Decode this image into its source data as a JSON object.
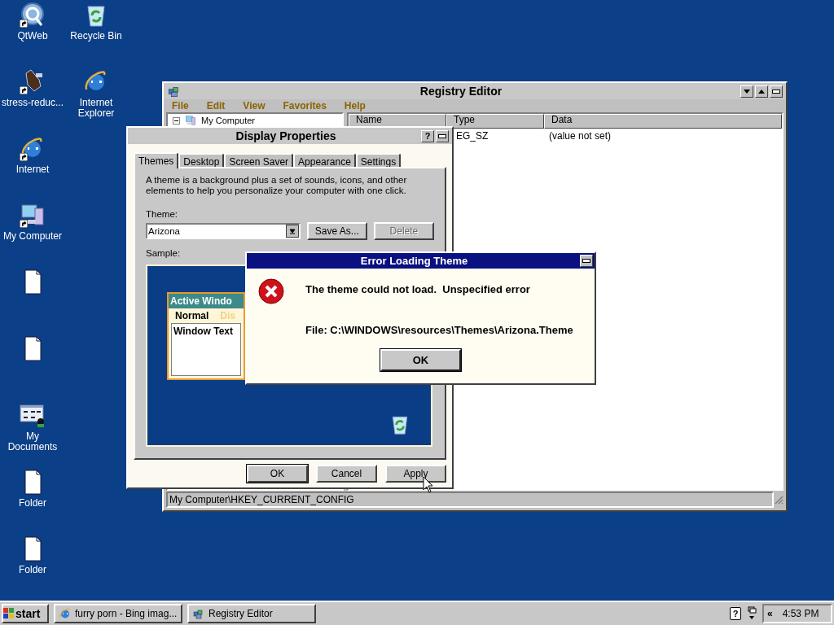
{
  "desktop_columns": [
    [
      {
        "label": "QtWeb",
        "kind": "qt",
        "shortcut": true
      },
      {
        "label": "stress-reduc...",
        "kind": "tool",
        "shortcut": true
      },
      {
        "label": "Internet",
        "kind": "ie",
        "shortcut": true
      },
      {
        "label": "My Computer",
        "kind": "computer",
        "shortcut": true
      },
      {
        "kind": "file",
        "shortcut": false
      },
      {
        "kind": "file",
        "shortcut": false
      },
      {
        "label": "My Documents",
        "kind": "documents",
        "shortcut": false
      },
      {
        "label": "Folder",
        "kind": "file",
        "shortcut": false
      },
      {
        "label": "Folder",
        "kind": "file",
        "shortcut": false
      }
    ],
    [
      {
        "label": "Recycle Bin",
        "kind": "recycle",
        "shortcut": false
      },
      {
        "label": "Internet Explorer",
        "kind": "ie",
        "shortcut": false
      }
    ]
  ],
  "registry_editor": {
    "title": "Registry Editor",
    "menu": [
      "File",
      "Edit",
      "View",
      "Favorites",
      "Help"
    ],
    "tree": {
      "label": "My Computer",
      "expanded": true
    },
    "columns": [
      "Name",
      "Type",
      "Data"
    ],
    "rows": [
      {
        "type": "EG_SZ",
        "data": "(value not set)"
      }
    ],
    "status_bar": "My Computer\\HKEY_CURRENT_CONFIG"
  },
  "display_properties": {
    "title": "Display Properties",
    "help": "?",
    "tabs": [
      {
        "label": "Themes",
        "selected": true
      },
      {
        "label": "Desktop",
        "selected": false
      },
      {
        "label": "Screen Saver",
        "selected": false
      },
      {
        "label": "Appearance",
        "selected": false
      },
      {
        "label": "Settings",
        "selected": false
      }
    ],
    "description": "A theme is a background plus a set of sounds, icons, and other elements to help you personalize your computer with one click.",
    "theme_label": "Theme:",
    "theme_value": "Arizona",
    "theme_buttons": [
      {
        "label": "Save As...",
        "disabled": false
      },
      {
        "label": "Delete",
        "disabled": true
      }
    ],
    "sample_label": "Sample:",
    "sample": {
      "title": "Active Windo",
      "normal": "Normal",
      "disabled": "Dis",
      "window_text": "Window Text"
    },
    "buttons": [
      {
        "label": "OK",
        "disabled": false
      },
      {
        "label": "Cancel",
        "disabled": false
      },
      {
        "label": "Apply",
        "disabled": false
      }
    ]
  },
  "error_dialog": {
    "title": "Error Loading Theme",
    "message": "The theme could not load.  Unspecified error",
    "file": "File: C:\\WINDOWS\\resources\\Themes\\Arizona.Theme",
    "button": "OK"
  },
  "taskbar": {
    "start": "start",
    "tasks": [
      {
        "label": "furry porn - Bing imag...",
        "kind": "ie",
        "selected": false
      },
      {
        "label": "Registry Editor",
        "kind": "regedit",
        "selected": false
      }
    ],
    "help": "?",
    "arrows": "«",
    "clock": "4:53 PM"
  }
}
